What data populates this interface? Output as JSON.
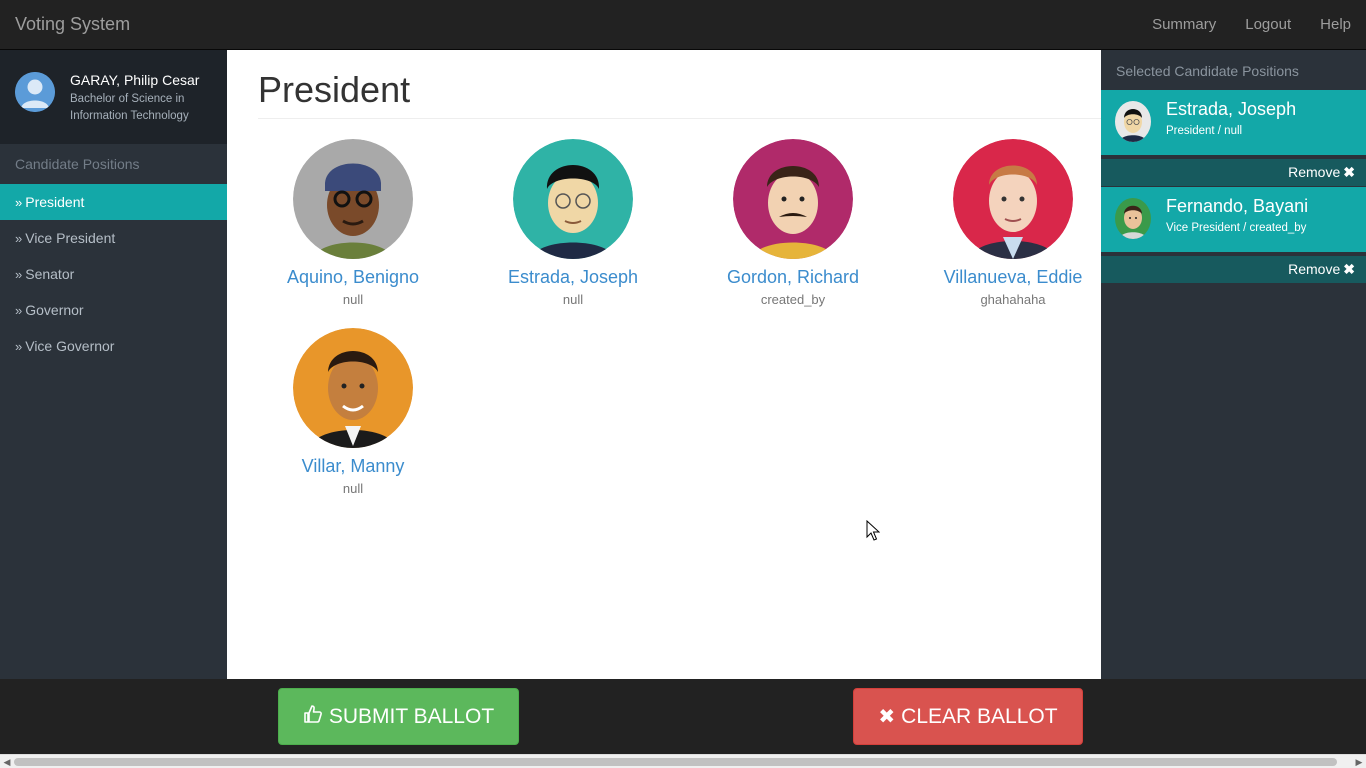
{
  "navbar": {
    "brand": "Voting System",
    "links": [
      "Summary",
      "Logout",
      "Help"
    ]
  },
  "sidebar": {
    "profile": {
      "name": "GARAY, Philip Cesar",
      "course": "Bachelor of Science in Information Technology"
    },
    "header": "Candidate Positions",
    "items": [
      {
        "label": "President",
        "active": true
      },
      {
        "label": "Vice President",
        "active": false
      },
      {
        "label": "Senator",
        "active": false
      },
      {
        "label": "Governor",
        "active": false
      },
      {
        "label": "Vice Governor",
        "active": false
      }
    ]
  },
  "main": {
    "title": "President",
    "candidates": [
      {
        "name": "Aquino, Benigno",
        "sub": "null"
      },
      {
        "name": "Estrada, Joseph",
        "sub": "null"
      },
      {
        "name": "Gordon, Richard",
        "sub": "created_by"
      },
      {
        "name": "Villanueva, Eddie",
        "sub": "ghahahaha"
      },
      {
        "name": "Villar, Manny",
        "sub": "null"
      }
    ]
  },
  "selected": {
    "header": "Selected Candidate Positions",
    "items": [
      {
        "name": "Estrada, Joseph",
        "detail": "President / null",
        "remove_label": "Remove"
      },
      {
        "name": "Fernando, Bayani",
        "detail": "Vice President / created_by",
        "remove_label": "Remove"
      }
    ]
  },
  "footer": {
    "submit_label": "SUBMIT BALLOT",
    "clear_label": "CLEAR BALLOT"
  },
  "colors": {
    "accent": "#13a8a8",
    "submit": "#5cb85c",
    "clear": "#d9534f",
    "sidebar_bg": "#2b323a",
    "navbar_bg": "#222222"
  }
}
